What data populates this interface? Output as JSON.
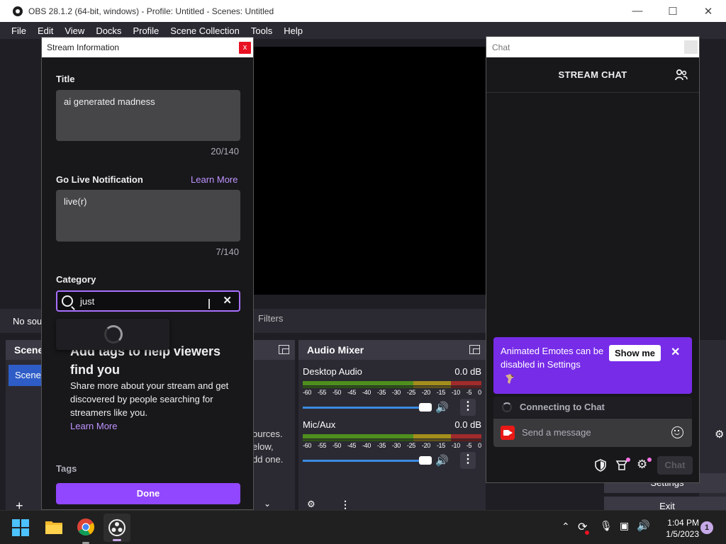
{
  "window": {
    "title": "OBS 28.1.2 (64-bit, windows) - Profile: Untitled - Scenes: Untitled"
  },
  "menu": [
    "File",
    "Edit",
    "View",
    "Docks",
    "Profile",
    "Scene Collection",
    "Tools",
    "Help"
  ],
  "source_bar": {
    "no_source": "No sou",
    "filters": "Filters"
  },
  "docks": {
    "scenes": {
      "title": "Scene",
      "item": "Scene"
    },
    "sources": {
      "hint_lines": [
        "ources.",
        "elow,",
        "dd one."
      ]
    },
    "audio_mixer": {
      "title": "Audio Mixer",
      "tracks": [
        {
          "name": "Desktop Audio",
          "level": "0.0 dB",
          "fader_fraction": 1.0
        },
        {
          "name": "Mic/Aux",
          "level": "0.0 dB",
          "fader_fraction": 1.0
        }
      ],
      "scale": [
        "-60",
        "-55",
        "-50",
        "-45",
        "-40",
        "-35",
        "-30",
        "-25",
        "-20",
        "-15",
        "-10",
        "-5",
        "0"
      ]
    },
    "controls": {
      "settings": "Settings",
      "exit": "Exit"
    }
  },
  "stream_info": {
    "dialog_title": "Stream Information",
    "close_glyph": "x",
    "title_label": "Title",
    "title_value": "ai generated madness",
    "title_count": "20/140",
    "notification_label": "Go Live Notification",
    "learn_more": "Learn More",
    "notification_value": "live(r)",
    "notification_count": "7/140",
    "category_label": "Category",
    "category_query": "just",
    "clear_glyph": "✕",
    "tags_heading": "Add tags to help viewers find you",
    "tags_desc": "Share more about your stream and get discovered by people searching for streamers like you.",
    "tags_learn_more": "Learn More",
    "tags_label": "Tags",
    "done": "Done"
  },
  "chat": {
    "window_title": "Chat",
    "header": "STREAM CHAT",
    "banner_text": "Animated Emotes can be disabled in Settings",
    "show_me": "Show me",
    "banner_close": "✕",
    "connecting": "Connecting to Chat",
    "send_placeholder": "Send a message",
    "chat_button": "Chat"
  },
  "taskbar": {
    "time": "1:04 PM",
    "date": "1/5/2023",
    "notifications": "1"
  },
  "colors": {
    "twitch_purple": "#9147ff",
    "banner_purple": "#772ce8",
    "link_purple": "#bf94ff",
    "obs_scene_blue": "#2e5dc7"
  }
}
